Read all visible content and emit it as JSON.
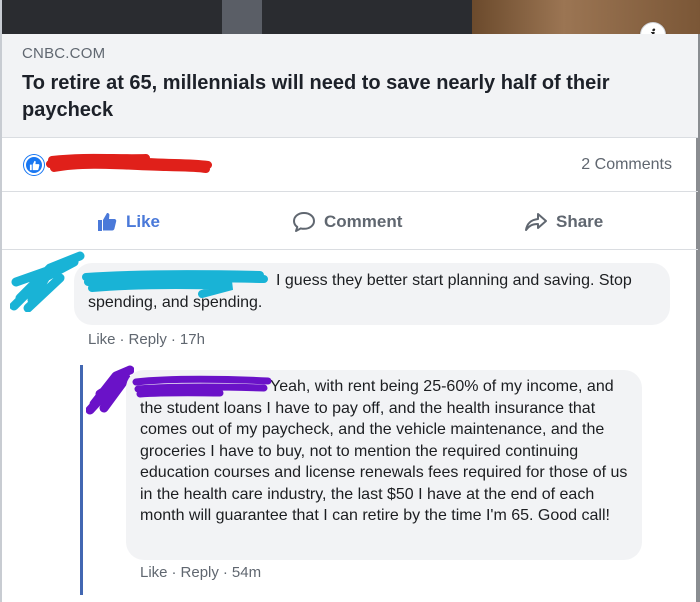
{
  "post": {
    "link": {
      "source": "CNBC.COM",
      "headline": "To retire at 65, millennials will need to save nearly half of their paycheck"
    },
    "comments_count": "2 Comments",
    "actions": {
      "like": "Like",
      "comment": "Comment",
      "share": "Share"
    },
    "icons": {
      "info": "info-icon",
      "like_badge": "thumbs-up-icon",
      "comment": "speech-bubble-icon",
      "share": "share-arrow-icon"
    }
  },
  "comments": [
    {
      "text": "I guess they better start planning and saving. Stop spending, and spending.",
      "like_label": "Like",
      "reply_label": "Reply",
      "time": "17h"
    },
    {
      "text": "Yeah, with rent being 25-60% of my income, and the student loans I have to pay off, and the health insurance that comes out of my paycheck, and the vehicle maintenance, and the groceries I have to buy, not to mention the required continuing education courses and license renewals fees required for those of us in the health care industry, the last $50 I have at the end of each month will guarantee that I can retire by the time I'm 65. Good call!",
      "like_label": "Like",
      "reply_label": "Reply",
      "time": "54m"
    }
  ],
  "colors": {
    "facebook_blue": "#1877f2",
    "like_text": "#4a79d9",
    "redaction_red": "#e0201a",
    "redaction_cyan": "#19b3d6",
    "redaction_purple": "#6a12c8"
  }
}
